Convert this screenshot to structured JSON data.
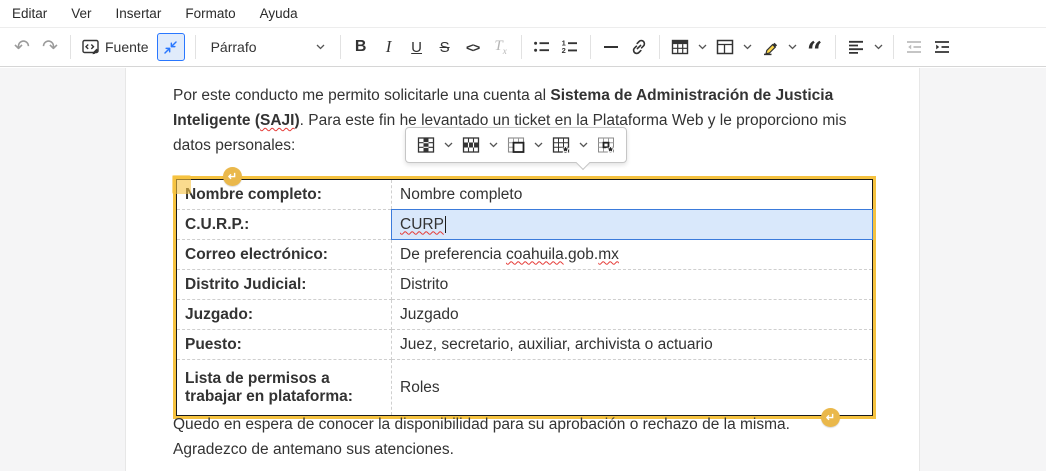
{
  "colors": {
    "accent-blue": "#2977ff",
    "widget-yellow": "#f5c240",
    "cell-sel-bg": "#d9e8fb",
    "cell-sel-border": "#3b7bdb",
    "spell-red": "#e53935",
    "highlighter-yellow": "#fbd64a"
  },
  "menu_bar": {
    "items": [
      "Editar",
      "Ver",
      "Insertar",
      "Formato",
      "Ayuda"
    ]
  },
  "toolbar": {
    "undo_glyph": "↶",
    "redo_glyph": "↷",
    "source_label": "Fuente",
    "paragraph_label": "Párrafo",
    "bold_glyph": "B",
    "italic_glyph": "I",
    "underline_glyph": "U",
    "strike_glyph": "S",
    "code_glyph": "<>",
    "remove_format_t": "T",
    "remove_format_x": "x",
    "quote_glyph": "“",
    "button_icons": [
      "undo-icon",
      "redo-icon",
      "source-editing-icon",
      "collapse-view-icon",
      "paragraph-dropdown",
      "bold-icon",
      "italic-icon",
      "underline-icon",
      "strikethrough-icon",
      "code-icon",
      "remove-format-icon",
      "bulleted-list-icon",
      "numbered-list-icon",
      "horizontal-line-icon",
      "link-icon",
      "insert-table-icon",
      "layout-table-icon",
      "highlighter-icon",
      "block-quote-icon",
      "text-alignment-icon",
      "outdent-icon",
      "indent-icon"
    ]
  },
  "balloon_toolbar": {
    "button_icons": [
      "table-column-icon",
      "table-row-icon",
      "merge-cells-icon",
      "table-properties-icon",
      "cell-properties-icon"
    ]
  },
  "document": {
    "paragraph1": {
      "text_start": "Por este conducto me permito solicitarle una cuenta al ",
      "bold_prefix": "Sistema de Administración de Justicia Inteligente (",
      "bold_spellcheck": "SAJI",
      "bold_suffix": ")",
      "text_end": ". Para este fin he levantado un ticket en la Plataforma Web y le proporciono mis datos personales:"
    },
    "table": {
      "rows": [
        {
          "label": "Nombre completo:",
          "value": "Nombre completo"
        },
        {
          "label": "C.U.R.P.:",
          "value": "CURP"
        },
        {
          "label": "Correo electrónico:",
          "value_p1": "De preferencia ",
          "value_sp1": "coahuila",
          "value_p2": ".gob.",
          "value_sp2": "mx"
        },
        {
          "label": "Distrito Judicial:",
          "value": "Distrito"
        },
        {
          "label": "Juzgado:",
          "value": "Juzgado"
        },
        {
          "label": "Puesto:",
          "value": "Juez, secretario, auxiliar, archivista o actuario"
        },
        {
          "label": "Lista de permisos a trabajar en plataforma:",
          "value": "Roles"
        }
      ]
    },
    "closing1": "Quedo en espera de conocer la disponibilidad para su aprobación o rechazo de la misma.",
    "closing2": "Agradezco de antemano sus atenciones.",
    "insert_paragraph_glyph": "↵"
  }
}
